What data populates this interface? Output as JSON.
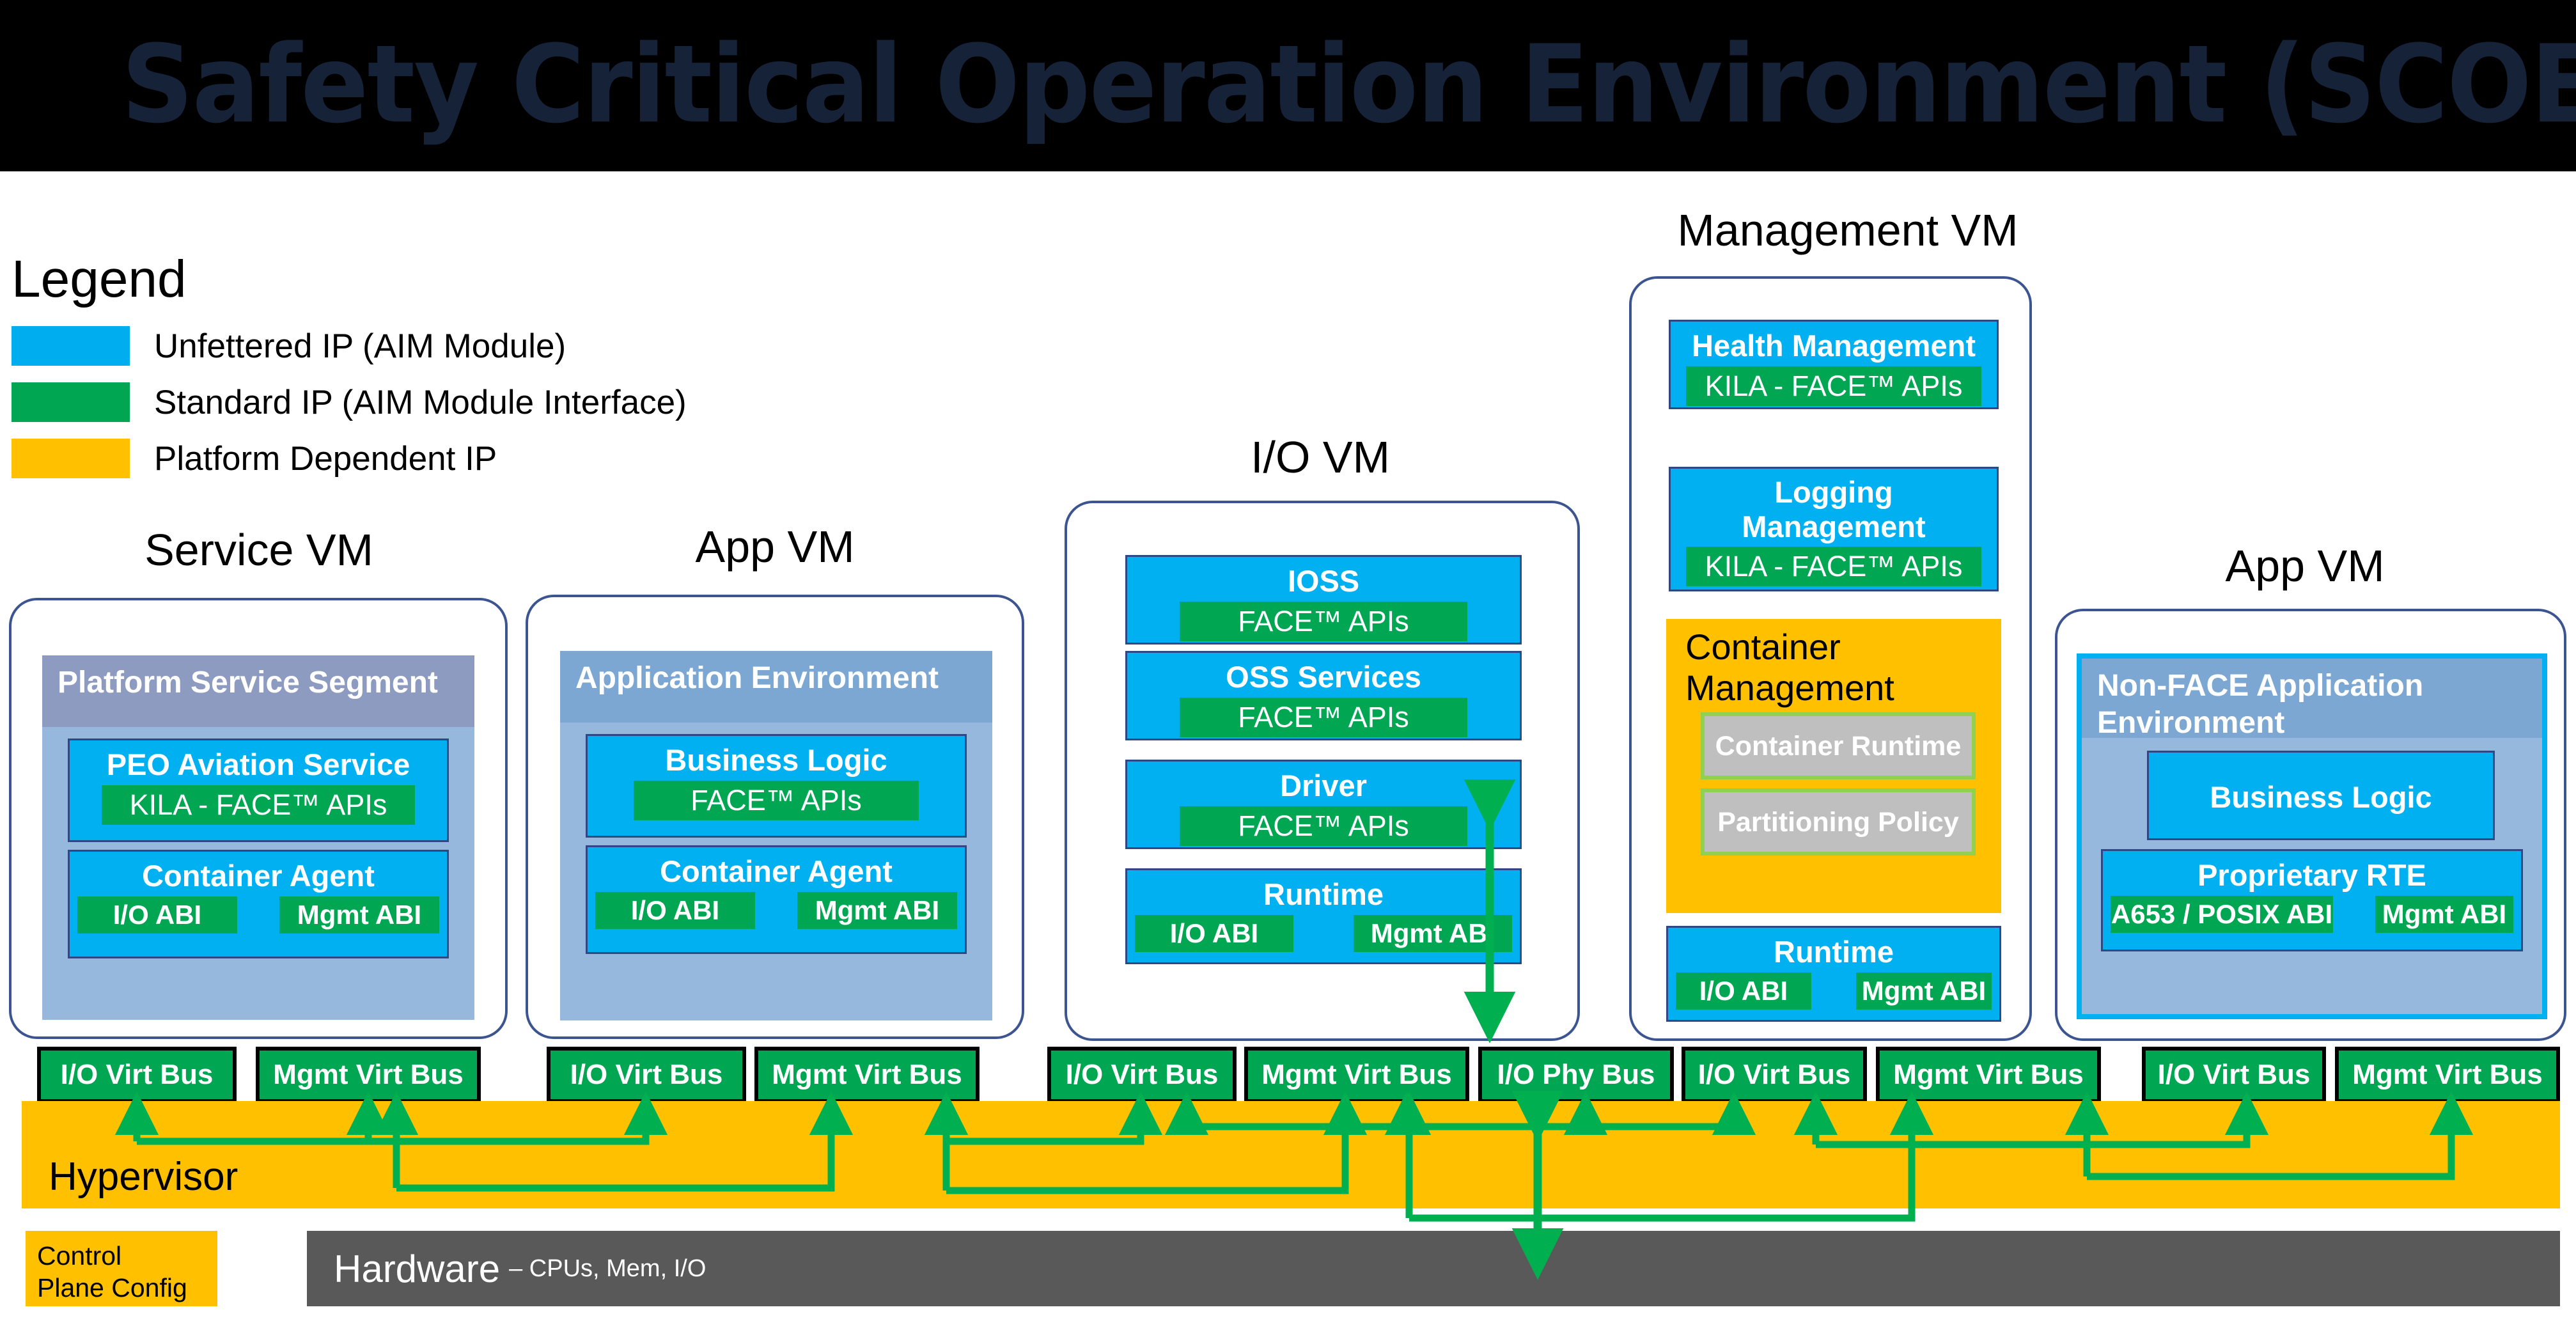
{
  "title": "Safety Critical Operation Environment (SCOE)",
  "legend": {
    "heading": "Legend",
    "items": [
      {
        "color": "#00AEEF",
        "label": "Unfettered IP (AIM Module)"
      },
      {
        "color": "#00A651",
        "label": "Standard IP (AIM Module Interface)"
      },
      {
        "color": "#FFC000",
        "label": "Platform Dependent IP"
      }
    ]
  },
  "vms": {
    "service": {
      "title": "Service VM",
      "panel_head": "Platform Service Segment",
      "modules": [
        {
          "title": "PEO Aviation Service",
          "api": "KILA - FACE™ APIs"
        },
        {
          "title": "Container Agent",
          "abi_left": "I/O ABI",
          "abi_right": "Mgmt ABI"
        }
      ]
    },
    "app_left": {
      "title": "App VM",
      "panel_head": "Application Environment",
      "modules": [
        {
          "title": "Business Logic",
          "api": "FACE™ APIs"
        },
        {
          "title": "Container Agent",
          "abi_left": "I/O ABI",
          "abi_right": "Mgmt ABI"
        }
      ]
    },
    "io": {
      "title": "I/O VM",
      "modules": [
        {
          "title": "IOSS",
          "api": "FACE™ APIs"
        },
        {
          "title": "OSS Services",
          "api": "FACE™ APIs"
        },
        {
          "title": "Driver",
          "api": "FACE™ APIs"
        },
        {
          "title": "Runtime",
          "abi_left": "I/O ABI",
          "abi_right": "Mgmt ABI"
        }
      ]
    },
    "management": {
      "title": "Management VM",
      "modules": [
        {
          "title": "Health Management",
          "api": "KILA - FACE™ APIs"
        },
        {
          "title": "Logging Management",
          "api": "KILA - FACE™ APIs"
        },
        {
          "title": "Runtime",
          "abi_left": "I/O ABI",
          "abi_right": "Mgmt ABI"
        }
      ],
      "container_management": {
        "title": "Container Management",
        "boxes": [
          "Container Runtime",
          "Partitioning Policy"
        ]
      }
    },
    "app_right": {
      "title": "App VM",
      "panel_head": "Non-FACE Application Environment",
      "modules": [
        {
          "title": "Business Logic"
        },
        {
          "title": "Proprietary RTE",
          "abi_left": "A653 / POSIX ABI",
          "abi_right": "Mgmt ABI"
        }
      ]
    }
  },
  "buses": [
    {
      "label": "I/O Virt Bus"
    },
    {
      "label": "Mgmt Virt Bus"
    },
    {
      "label": "I/O Virt Bus"
    },
    {
      "label": "Mgmt Virt Bus"
    },
    {
      "label": "I/O Virt Bus"
    },
    {
      "label": "Mgmt Virt Bus"
    },
    {
      "label": "I/O Phy Bus"
    },
    {
      "label": "I/O Virt Bus"
    },
    {
      "label": "Mgmt Virt Bus"
    },
    {
      "label": "I/O Virt Bus"
    },
    {
      "label": "Mgmt Virt Bus"
    }
  ],
  "hypervisor": {
    "label": "Hypervisor"
  },
  "hardware": {
    "label": "Hardware",
    "sub": "– CPUs, Mem, I/O"
  },
  "control_plane": {
    "line1": "Control",
    "line2": "Plane Config"
  }
}
